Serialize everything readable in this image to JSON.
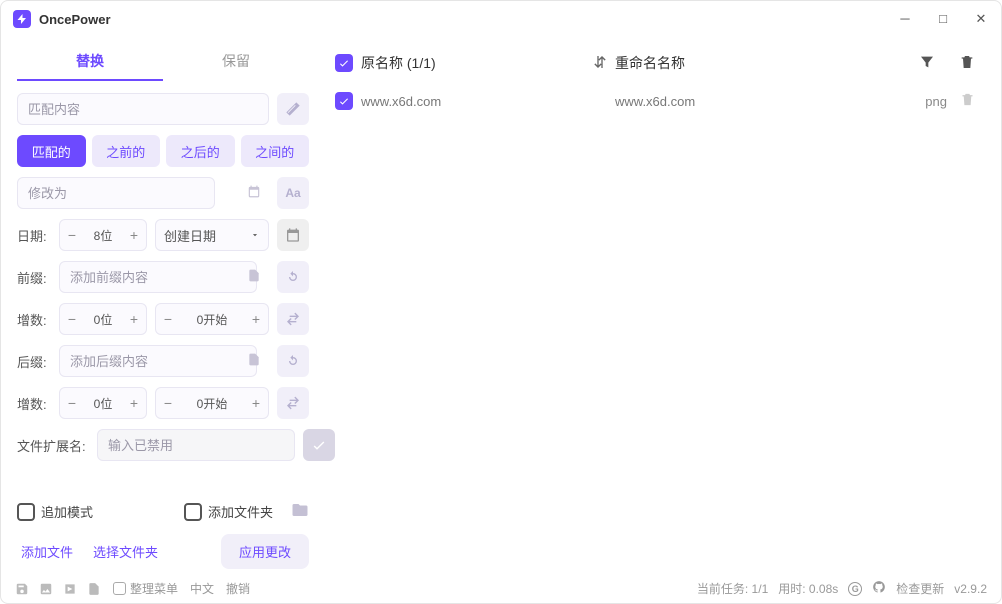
{
  "app": {
    "title": "OncePower"
  },
  "tabs": {
    "replace": "替换",
    "keep": "保留"
  },
  "match": {
    "placeholder": "匹配内容"
  },
  "segments": {
    "match": "匹配的",
    "before": "之前的",
    "after": "之后的",
    "between": "之间的"
  },
  "replaceTo": {
    "placeholder": "修改为"
  },
  "date": {
    "label": "日期:",
    "digits": "8位",
    "type": "创建日期"
  },
  "prefix": {
    "label": "前缀:",
    "placeholder": "添加前缀内容"
  },
  "prefixInc": {
    "label": "增数:",
    "digits": "0位",
    "start": "0开始"
  },
  "suffix": {
    "label": "后缀:",
    "placeholder": "添加后缀内容"
  },
  "suffixInc": {
    "label": "增数:",
    "digits": "0位",
    "start": "0开始"
  },
  "ext": {
    "label": "文件扩展名:",
    "placeholder": "输入已禁用"
  },
  "bottom": {
    "append": "追加模式",
    "addFolder": "添加文件夹",
    "addFile": "添加文件",
    "selectFolder": "选择文件夹",
    "apply": "应用更改"
  },
  "list": {
    "header": {
      "original": "原名称 (1/1)",
      "renamed": "重命名名称"
    },
    "rows": [
      {
        "original": "www.x6d.com",
        "renamed": "www.x6d.com",
        "ext": "png"
      }
    ]
  },
  "status": {
    "organize": "整理菜单",
    "lang": "中文",
    "undo": "撤销",
    "task": "当前任务: 1/1",
    "time": "用时: 0.08s",
    "update": "检查更新",
    "version": "v2.9.2"
  }
}
